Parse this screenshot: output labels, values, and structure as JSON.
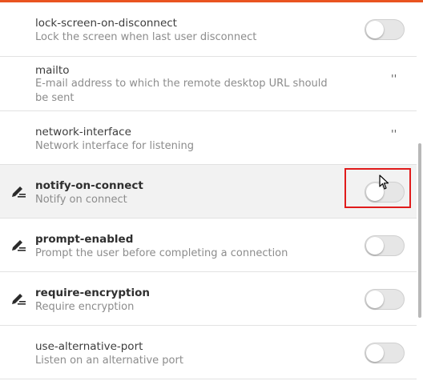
{
  "accent_color": "#e95420",
  "highlight_color": "#e01b1b",
  "rows": [
    {
      "key": "lock-screen-on-disconnect",
      "desc": "Lock the screen when last user disconnect",
      "control": "toggle",
      "state": false,
      "modified": false
    },
    {
      "key": "mailto",
      "desc": "E-mail address to which the remote desktop URL should be sent",
      "control": "value",
      "value": "''",
      "modified": false
    },
    {
      "key": "network-interface",
      "desc": "Network interface for listening",
      "control": "value",
      "value": "''",
      "modified": false
    },
    {
      "key": "notify-on-connect",
      "desc": "Notify on connect",
      "control": "toggle",
      "state": false,
      "modified": true,
      "icon": "edit-icon"
    },
    {
      "key": "prompt-enabled",
      "desc": "Prompt the user before completing a connection",
      "control": "toggle",
      "state": false,
      "modified": true,
      "icon": "edit-icon"
    },
    {
      "key": "require-encryption",
      "desc": "Require encryption",
      "control": "toggle",
      "state": false,
      "modified": true,
      "icon": "edit-icon"
    },
    {
      "key": "use-alternative-port",
      "desc": "Listen on an alternative port",
      "control": "toggle",
      "state": false,
      "modified": false
    }
  ]
}
